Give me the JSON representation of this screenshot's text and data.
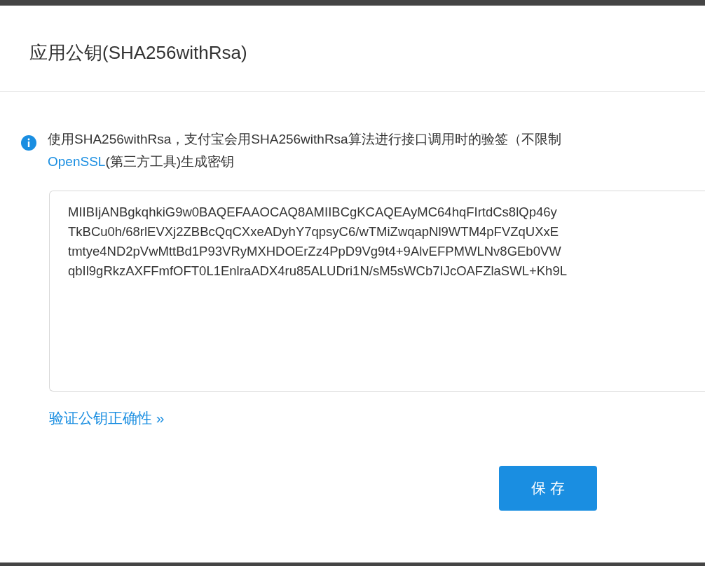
{
  "dialog": {
    "title": "应用公钥(SHA256withRsa)",
    "notice": {
      "text": "使用SHA256withRsa，支付宝会用SHA256withRsa算法进行接口调用时的验签（不限制",
      "link": "OpenSSL",
      "text_after": "(第三方工具)生成密钥"
    },
    "key_lines": [
      "MIIBIjANBgkqhkiG9w0BAQEFAAOCAQ8AMIIBCgKCAQEAyMC64hqFIrtdCs8lQp46y",
      "TkBCu0h/68rlEVXj2ZBBcQqCXxeADyhY7qpsyC6/wTMiZwqapNl9WTM4pFVZqUXxE",
      "tmtye4ND2pVwMttBd1P93VRyMXHDOErZz4PpD9Vg9t4+9AlvEFPMWLNv8GEb0VW",
      "qbIl9gRkzAXFFmfOFT0L1EnlraADX4ru85ALUDri1N/sM5sWCb7IJcOAFZlaSWL+Kh9L"
    ],
    "verify_link": "验证公钥正确性 »",
    "buttons": [
      {
        "label": "保 存",
        "kind": "primary"
      }
    ]
  }
}
